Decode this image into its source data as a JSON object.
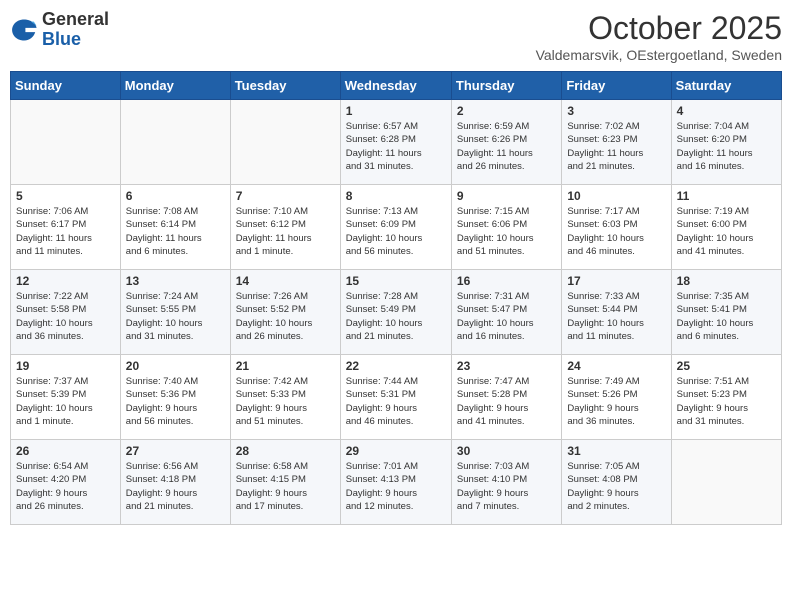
{
  "header": {
    "logo_general": "General",
    "logo_blue": "Blue",
    "month": "October 2025",
    "location": "Valdemarsvik, OEstergoetland, Sweden"
  },
  "days_of_week": [
    "Sunday",
    "Monday",
    "Tuesday",
    "Wednesday",
    "Thursday",
    "Friday",
    "Saturday"
  ],
  "weeks": [
    [
      {
        "num": "",
        "info": ""
      },
      {
        "num": "",
        "info": ""
      },
      {
        "num": "",
        "info": ""
      },
      {
        "num": "1",
        "info": "Sunrise: 6:57 AM\nSunset: 6:28 PM\nDaylight: 11 hours\nand 31 minutes."
      },
      {
        "num": "2",
        "info": "Sunrise: 6:59 AM\nSunset: 6:26 PM\nDaylight: 11 hours\nand 26 minutes."
      },
      {
        "num": "3",
        "info": "Sunrise: 7:02 AM\nSunset: 6:23 PM\nDaylight: 11 hours\nand 21 minutes."
      },
      {
        "num": "4",
        "info": "Sunrise: 7:04 AM\nSunset: 6:20 PM\nDaylight: 11 hours\nand 16 minutes."
      }
    ],
    [
      {
        "num": "5",
        "info": "Sunrise: 7:06 AM\nSunset: 6:17 PM\nDaylight: 11 hours\nand 11 minutes."
      },
      {
        "num": "6",
        "info": "Sunrise: 7:08 AM\nSunset: 6:14 PM\nDaylight: 11 hours\nand 6 minutes."
      },
      {
        "num": "7",
        "info": "Sunrise: 7:10 AM\nSunset: 6:12 PM\nDaylight: 11 hours\nand 1 minute."
      },
      {
        "num": "8",
        "info": "Sunrise: 7:13 AM\nSunset: 6:09 PM\nDaylight: 10 hours\nand 56 minutes."
      },
      {
        "num": "9",
        "info": "Sunrise: 7:15 AM\nSunset: 6:06 PM\nDaylight: 10 hours\nand 51 minutes."
      },
      {
        "num": "10",
        "info": "Sunrise: 7:17 AM\nSunset: 6:03 PM\nDaylight: 10 hours\nand 46 minutes."
      },
      {
        "num": "11",
        "info": "Sunrise: 7:19 AM\nSunset: 6:00 PM\nDaylight: 10 hours\nand 41 minutes."
      }
    ],
    [
      {
        "num": "12",
        "info": "Sunrise: 7:22 AM\nSunset: 5:58 PM\nDaylight: 10 hours\nand 36 minutes."
      },
      {
        "num": "13",
        "info": "Sunrise: 7:24 AM\nSunset: 5:55 PM\nDaylight: 10 hours\nand 31 minutes."
      },
      {
        "num": "14",
        "info": "Sunrise: 7:26 AM\nSunset: 5:52 PM\nDaylight: 10 hours\nand 26 minutes."
      },
      {
        "num": "15",
        "info": "Sunrise: 7:28 AM\nSunset: 5:49 PM\nDaylight: 10 hours\nand 21 minutes."
      },
      {
        "num": "16",
        "info": "Sunrise: 7:31 AM\nSunset: 5:47 PM\nDaylight: 10 hours\nand 16 minutes."
      },
      {
        "num": "17",
        "info": "Sunrise: 7:33 AM\nSunset: 5:44 PM\nDaylight: 10 hours\nand 11 minutes."
      },
      {
        "num": "18",
        "info": "Sunrise: 7:35 AM\nSunset: 5:41 PM\nDaylight: 10 hours\nand 6 minutes."
      }
    ],
    [
      {
        "num": "19",
        "info": "Sunrise: 7:37 AM\nSunset: 5:39 PM\nDaylight: 10 hours\nand 1 minute."
      },
      {
        "num": "20",
        "info": "Sunrise: 7:40 AM\nSunset: 5:36 PM\nDaylight: 9 hours\nand 56 minutes."
      },
      {
        "num": "21",
        "info": "Sunrise: 7:42 AM\nSunset: 5:33 PM\nDaylight: 9 hours\nand 51 minutes."
      },
      {
        "num": "22",
        "info": "Sunrise: 7:44 AM\nSunset: 5:31 PM\nDaylight: 9 hours\nand 46 minutes."
      },
      {
        "num": "23",
        "info": "Sunrise: 7:47 AM\nSunset: 5:28 PM\nDaylight: 9 hours\nand 41 minutes."
      },
      {
        "num": "24",
        "info": "Sunrise: 7:49 AM\nSunset: 5:26 PM\nDaylight: 9 hours\nand 36 minutes."
      },
      {
        "num": "25",
        "info": "Sunrise: 7:51 AM\nSunset: 5:23 PM\nDaylight: 9 hours\nand 31 minutes."
      }
    ],
    [
      {
        "num": "26",
        "info": "Sunrise: 6:54 AM\nSunset: 4:20 PM\nDaylight: 9 hours\nand 26 minutes."
      },
      {
        "num": "27",
        "info": "Sunrise: 6:56 AM\nSunset: 4:18 PM\nDaylight: 9 hours\nand 21 minutes."
      },
      {
        "num": "28",
        "info": "Sunrise: 6:58 AM\nSunset: 4:15 PM\nDaylight: 9 hours\nand 17 minutes."
      },
      {
        "num": "29",
        "info": "Sunrise: 7:01 AM\nSunset: 4:13 PM\nDaylight: 9 hours\nand 12 minutes."
      },
      {
        "num": "30",
        "info": "Sunrise: 7:03 AM\nSunset: 4:10 PM\nDaylight: 9 hours\nand 7 minutes."
      },
      {
        "num": "31",
        "info": "Sunrise: 7:05 AM\nSunset: 4:08 PM\nDaylight: 9 hours\nand 2 minutes."
      },
      {
        "num": "",
        "info": ""
      }
    ]
  ]
}
